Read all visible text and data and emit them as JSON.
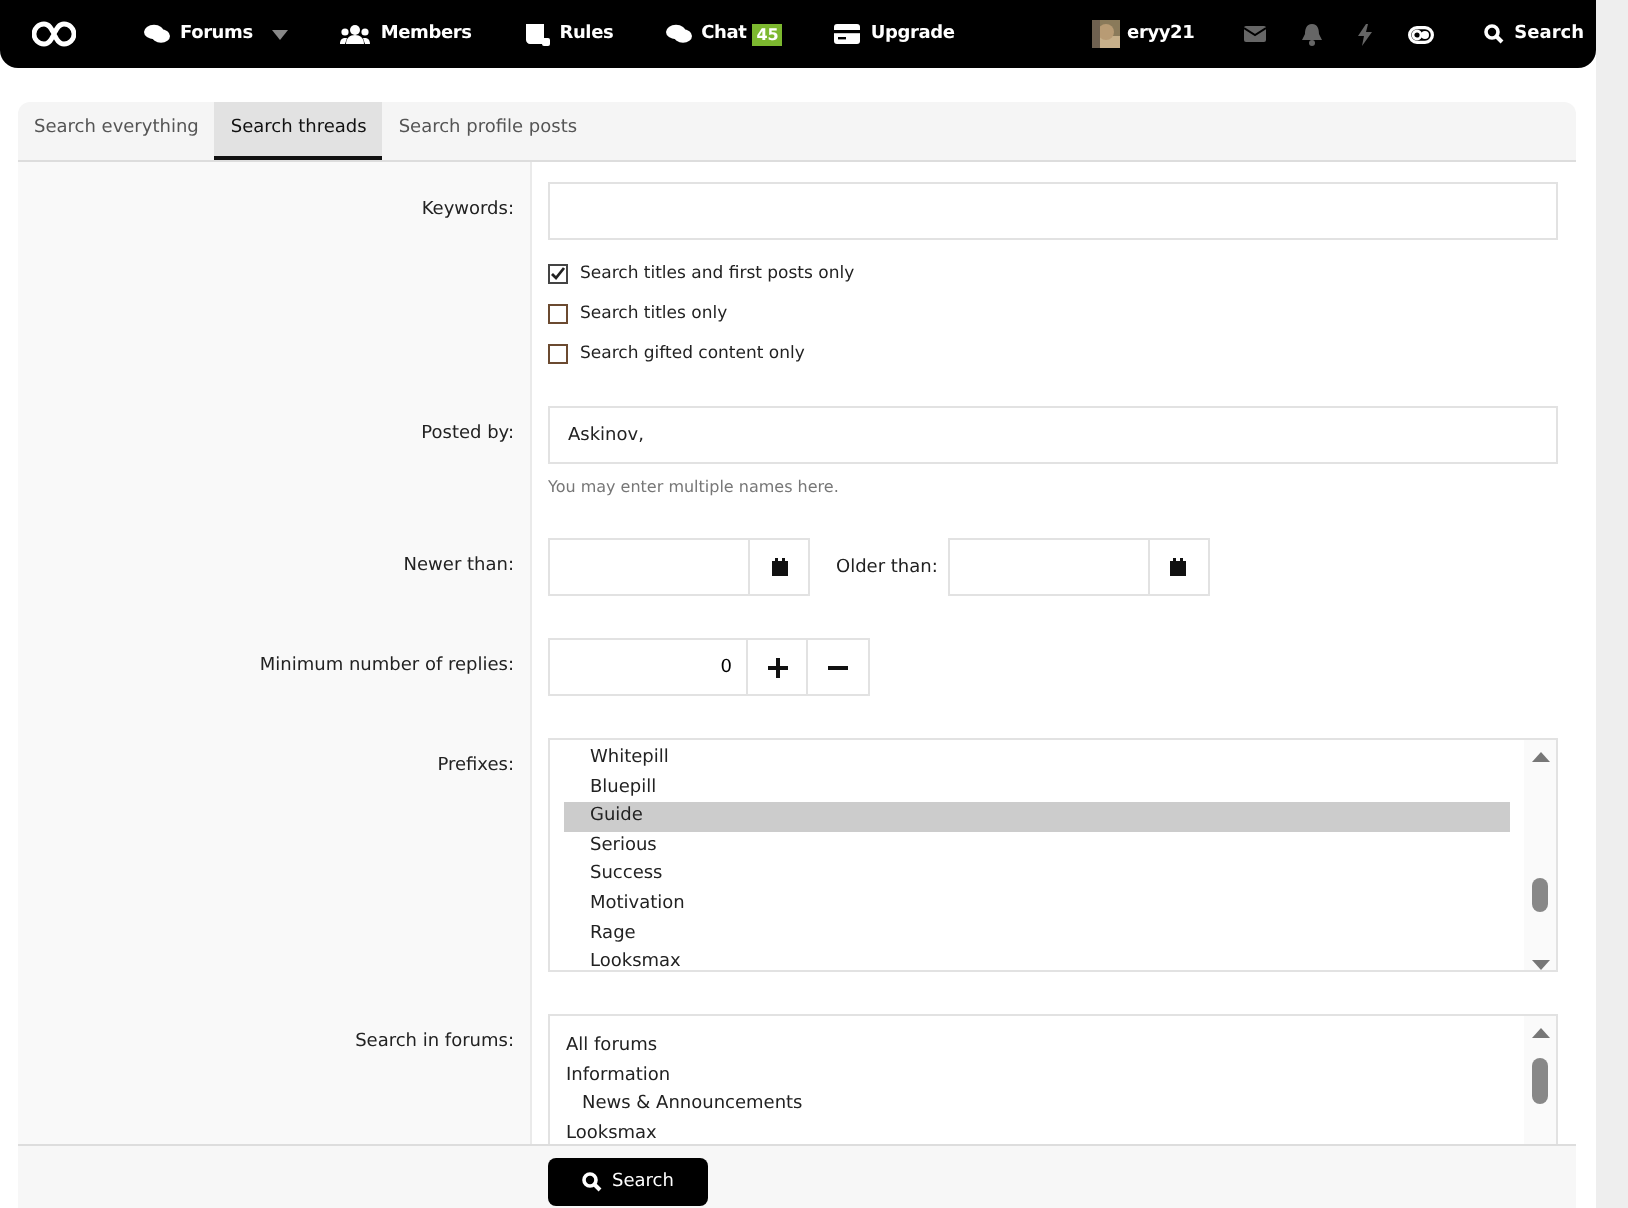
{
  "nav": {
    "items": [
      {
        "label": "Forums",
        "dropdown": true
      },
      {
        "label": "Members",
        "dropdown": false
      },
      {
        "label": "Rules",
        "dropdown": false
      },
      {
        "label": "Chat",
        "dropdown": false,
        "badge": "45"
      },
      {
        "label": "Upgrade",
        "dropdown": false
      }
    ],
    "user": {
      "name": "eryy21"
    },
    "search": {
      "label": "Search"
    }
  },
  "tabs": [
    {
      "label": "Search everything",
      "selected": false
    },
    {
      "label": "Search threads",
      "selected": true
    },
    {
      "label": "Search profile posts",
      "selected": false
    }
  ],
  "form": {
    "keywords": {
      "label": "Keywords:"
    },
    "options": [
      {
        "label": "Search titles and first posts only",
        "checked": true
      },
      {
        "label": "Search titles only",
        "checked": false
      },
      {
        "label": "Search gifted content only",
        "checked": false
      }
    ],
    "posted_by": {
      "label": "Posted by:",
      "value": "Askinov,",
      "hint": "You may enter multiple names here."
    },
    "newer_than": {
      "label": "Newer than:"
    },
    "older_than": {
      "label": "Older than:"
    },
    "min_replies": {
      "label": "Minimum number of replies:",
      "value": "0"
    },
    "prefixes": {
      "label": "Prefixes:",
      "items": [
        {
          "label": "Whitepill",
          "selected": false
        },
        {
          "label": "Bluepill",
          "selected": false
        },
        {
          "label": "Guide",
          "selected": true
        },
        {
          "label": "Serious",
          "selected": false
        },
        {
          "label": "Success",
          "selected": false
        },
        {
          "label": "Motivation",
          "selected": false
        },
        {
          "label": "Rage",
          "selected": false
        },
        {
          "label": "Looksmax",
          "selected": false
        }
      ]
    },
    "search_in_forums": {
      "label": "Search in forums:",
      "items": [
        {
          "label": "All forums"
        },
        {
          "label": "Information",
          "children": [
            {
              "label": "News & Announcements"
            }
          ]
        },
        {
          "label": "Looksmax"
        }
      ]
    }
  },
  "submit": {
    "label": "Search"
  }
}
